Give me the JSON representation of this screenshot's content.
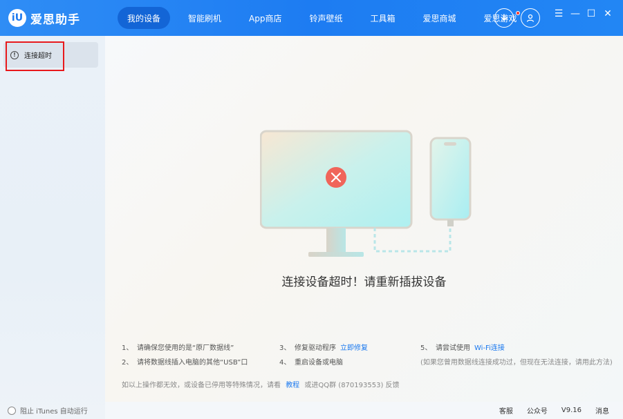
{
  "app": {
    "name": "爱思助手",
    "logo_glyph": "iU"
  },
  "nav": [
    {
      "label": "我的设备",
      "active": true
    },
    {
      "label": "智能刷机"
    },
    {
      "label": "App商店"
    },
    {
      "label": "铃声壁纸"
    },
    {
      "label": "工具箱"
    },
    {
      "label": "爱思商城"
    },
    {
      "label": "爱思游戏",
      "badge": true
    }
  ],
  "toolbar": {
    "download_icon": "download-icon",
    "user_icon": "user-icon"
  },
  "window": {
    "menu": "☰",
    "minimize": "—",
    "maximize": "☐",
    "close": "✕"
  },
  "sidebar": {
    "device_tab_label": "连接超时",
    "device_tab_icon": "!"
  },
  "main": {
    "headline": "连接设备超时！请重新插拔设备",
    "tips": {
      "col1": [
        {
          "num": "1、",
          "text": "请确保您使用的是“原厂数据线”"
        },
        {
          "num": "2、",
          "text": "请将数据线插入电脑的其他“USB”口"
        }
      ],
      "col2": [
        {
          "num": "3、",
          "text": "修复驱动程序",
          "link": "立即修复"
        },
        {
          "num": "4、",
          "text": "重启设备或电脑"
        }
      ],
      "col3": [
        {
          "num": "5、",
          "text": "请尝试使用",
          "link": "Wi-Fi连接"
        },
        {
          "note": "(如果您曾用数据线连接成功过，但现在无法连接，请用此方法)"
        }
      ]
    },
    "footer_note": {
      "before": "如以上操作都无效，或设备已停用等特殊情况，请看",
      "link": "教程",
      "after": "或进QQ群 (870193553) 反馈"
    }
  },
  "statusbar": {
    "itunes_label": "阻止 iTunes 自动运行",
    "service": "客服",
    "official": "公众号",
    "version": "V9.16",
    "messages": "消息"
  },
  "colors": {
    "brand": "#1d7cf2",
    "active_nav": "#1365d6",
    "error": "#f0655a",
    "link": "#1a78ef"
  }
}
